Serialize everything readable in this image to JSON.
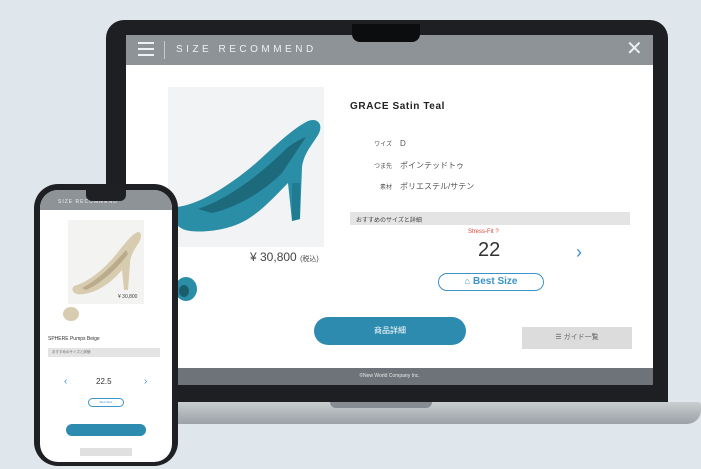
{
  "header": {
    "title": "SIZE RECOMMEND"
  },
  "product": {
    "name": "GRACE Satin Teal",
    "price": "¥ 30,800",
    "price_tax": "(税込)",
    "specs": [
      {
        "key": "ワイズ",
        "value": "D"
      },
      {
        "key": "つま先",
        "value": "ポインテッドトゥ"
      },
      {
        "key": "素材",
        "value": "ポリエステル/サテン"
      }
    ]
  },
  "recommendation": {
    "bar_label": "おすすめのサイズと詳細",
    "note": "Stress-Fit ?",
    "size": "22",
    "best_size_label": "Best Size"
  },
  "actions": {
    "primary_label": "商品詳細",
    "secondary_label": "☰ ガイド一覧"
  },
  "footer": {
    "text": "©New World Company Inc."
  },
  "phone": {
    "header_title": "SIZE RECOMMEND",
    "price": "¥ 30,800",
    "product_name": "SPHERE Pumps Beige",
    "rec_bar_label": "おすすめのサイズと詳細",
    "size": "22.5",
    "best_size_label": "Best Size"
  },
  "colors": {
    "accent": "#2e8bb0",
    "header": "#8e9397",
    "shoe_teal": "#2a8ea6",
    "shoe_beige": "#d8ccb0"
  },
  "icons": {
    "menu": "hamburger-icon",
    "close": "close-icon",
    "next": "chevron-right-icon",
    "prev": "chevron-left-icon",
    "badge": "shoe-icon"
  }
}
